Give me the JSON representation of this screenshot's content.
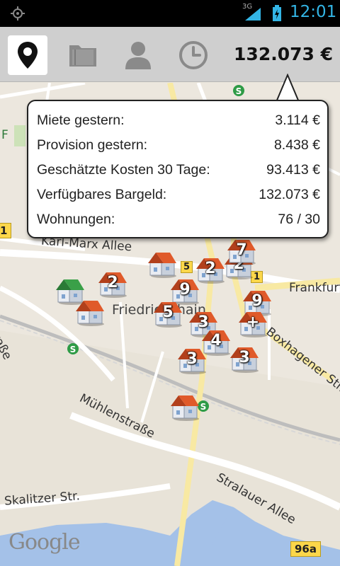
{
  "status_bar": {
    "network": "3G",
    "time": "12:01",
    "icon_color": "#33b5e5"
  },
  "toolbar": {
    "tabs": [
      {
        "icon": "map-pin-icon",
        "active": true
      },
      {
        "icon": "folder-icon",
        "active": false
      },
      {
        "icon": "person-icon",
        "active": false
      },
      {
        "icon": "clock-icon",
        "active": false
      }
    ],
    "balance": "132.073 €"
  },
  "popup": {
    "rows": [
      {
        "label": "Miete gestern:",
        "value": "3.114 €"
      },
      {
        "label": "Provision gestern:",
        "value": "8.438 €"
      },
      {
        "label": "Geschätzte Kosten 30 Tage:",
        "value": "93.413 €"
      },
      {
        "label": "Verfügbares Bargeld:",
        "value": "132.073 €"
      },
      {
        "label": "Wohnungen:",
        "value": "76 / 30"
      }
    ]
  },
  "map": {
    "streets": {
      "karl_marx": "Karl-Marx Allee",
      "frankfurter": "Frankfurt",
      "boxhagener": "Boxhagener Str.",
      "koppen": "Straße",
      "muehlen": "Mühlenstraße",
      "stralauer": "Stralauer Allee",
      "skalitzer": "Skalitzer Str.",
      "district": "Friedrichshain",
      "fragment_f": "F"
    },
    "badges": {
      "b96a": "96a",
      "b1_left": "1",
      "b5": "5",
      "b1_right": "1"
    },
    "houses": [
      {
        "num": "",
        "roof": "green"
      },
      {
        "num": "",
        "roof": "orange"
      },
      {
        "num": "2",
        "roof": "orange"
      },
      {
        "num": "",
        "roof": "orange"
      },
      {
        "num": "2",
        "roof": "orange"
      },
      {
        "num": "2",
        "roof": "orange"
      },
      {
        "num": "7",
        "roof": "orange"
      },
      {
        "num": "9",
        "roof": "orange"
      },
      {
        "num": "5",
        "roof": "orange"
      },
      {
        "num": "9",
        "roof": "orange"
      },
      {
        "num": "3",
        "roof": "orange"
      },
      {
        "num": "+",
        "roof": "orange"
      },
      {
        "num": "4",
        "roof": "orange"
      },
      {
        "num": "3",
        "roof": "orange"
      },
      {
        "num": "3",
        "roof": "orange"
      },
      {
        "num": "",
        "roof": "orange"
      }
    ],
    "attribution": "Google"
  }
}
